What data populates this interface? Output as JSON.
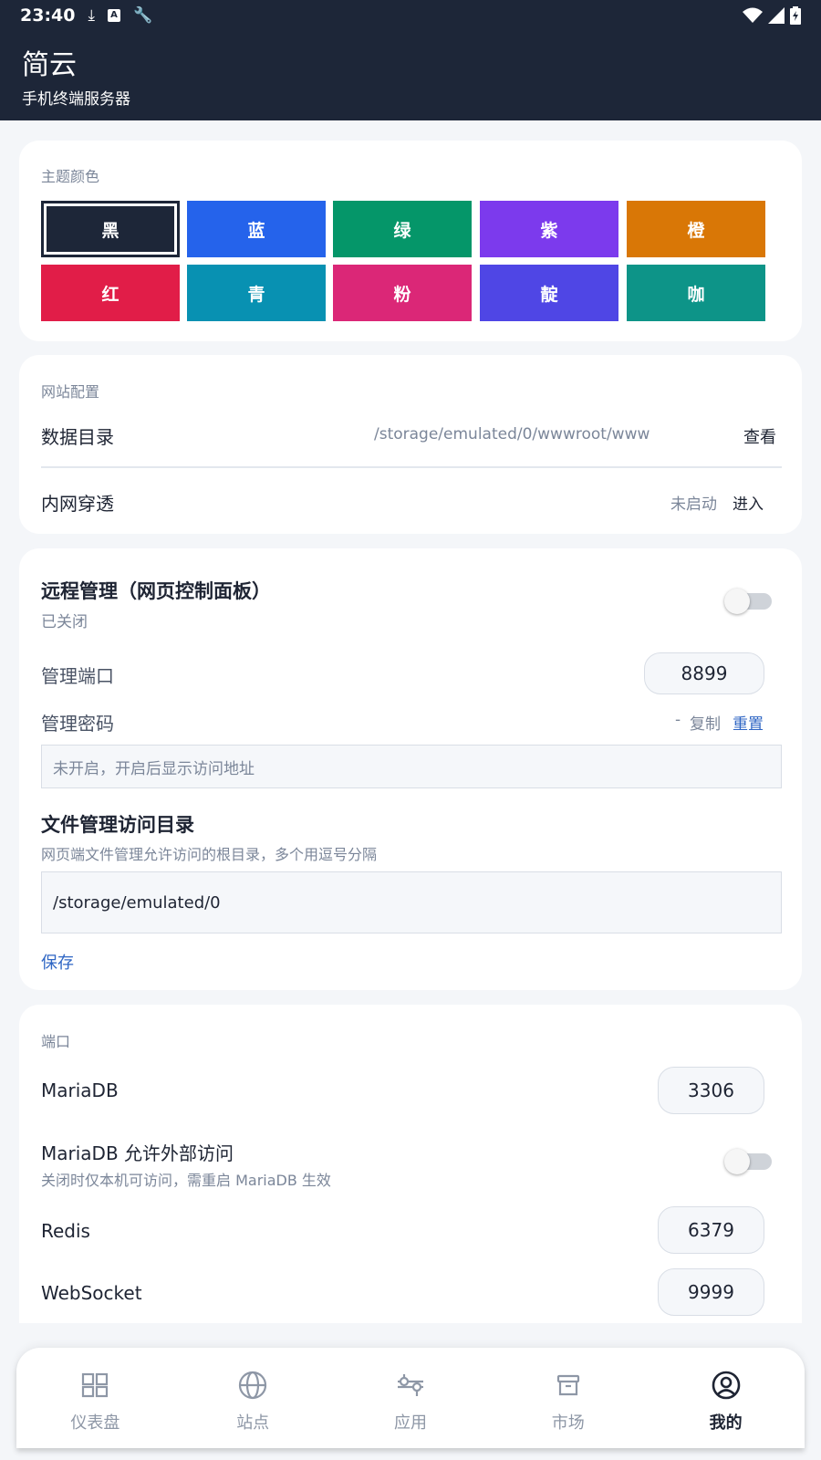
{
  "status_bar": {
    "time": "23:40",
    "icons": [
      "download-icon",
      "font-a-icon",
      "wrench-icon"
    ],
    "right_icons": [
      "wifi-icon",
      "signal-icon",
      "battery-charging-icon"
    ]
  },
  "app": {
    "title": "简云",
    "subtitle": "手机终端服务器"
  },
  "theme": {
    "section_title": "主题颜色",
    "colors": [
      {
        "label": "黑",
        "color": "#1d2638",
        "selected": true
      },
      {
        "label": "蓝",
        "color": "#2563eb",
        "selected": false
      },
      {
        "label": "绿",
        "color": "#059669",
        "selected": false
      },
      {
        "label": "紫",
        "color": "#7c3aed",
        "selected": false
      },
      {
        "label": "橙",
        "color": "#d97706",
        "selected": false
      },
      {
        "label": "红",
        "color": "#e11d48",
        "selected": false
      },
      {
        "label": "青",
        "color": "#0891b2",
        "selected": false
      },
      {
        "label": "粉",
        "color": "#db2777",
        "selected": false
      },
      {
        "label": "靛",
        "color": "#4f46e5",
        "selected": false
      },
      {
        "label": "咖",
        "color": "#0d9488",
        "selected": false
      }
    ]
  },
  "site_config": {
    "section_title": "网站配置",
    "data_dir_label": "数据目录",
    "data_dir_value": "/storage/emulated/0/wwwroot/www",
    "data_dir_action": "查看",
    "tunnel_label": "内网穿透",
    "tunnel_status": "未启动",
    "tunnel_action": "进入"
  },
  "remote": {
    "title": "远程管理（网页控制面板）",
    "status": "已关闭",
    "enabled": false,
    "port_label": "管理端口",
    "port_value": "8899",
    "password_label": "管理密码",
    "password_value": "-",
    "copy_label": "复制",
    "reset_label": "重置",
    "address_placeholder": "未开启，开启后显示访问地址",
    "file_title": "文件管理访问目录",
    "file_desc": "网页端文件管理允许访问的根目录，多个用逗号分隔",
    "file_value": "/storage/emulated/0",
    "save_label": "保存"
  },
  "ports": {
    "section_title": "端口",
    "mariadb_label": "MariaDB",
    "mariadb_value": "3306",
    "mariadb_external_label": "MariaDB 允许外部访问",
    "mariadb_external_desc": "关闭时仅本机可访问，需重启 MariaDB 生效",
    "mariadb_external_enabled": false,
    "redis_label": "Redis",
    "redis_value": "6379",
    "websocket_label": "WebSocket",
    "websocket_value": "9999"
  },
  "nav": {
    "items": [
      {
        "label": "仪表盘",
        "icon": "dashboard-icon",
        "active": false
      },
      {
        "label": "站点",
        "icon": "globe-icon",
        "active": false
      },
      {
        "label": "应用",
        "icon": "apps-icon",
        "active": false
      },
      {
        "label": "市场",
        "icon": "archive-icon",
        "active": false
      },
      {
        "label": "我的",
        "icon": "user-circle-icon",
        "active": true
      }
    ]
  }
}
